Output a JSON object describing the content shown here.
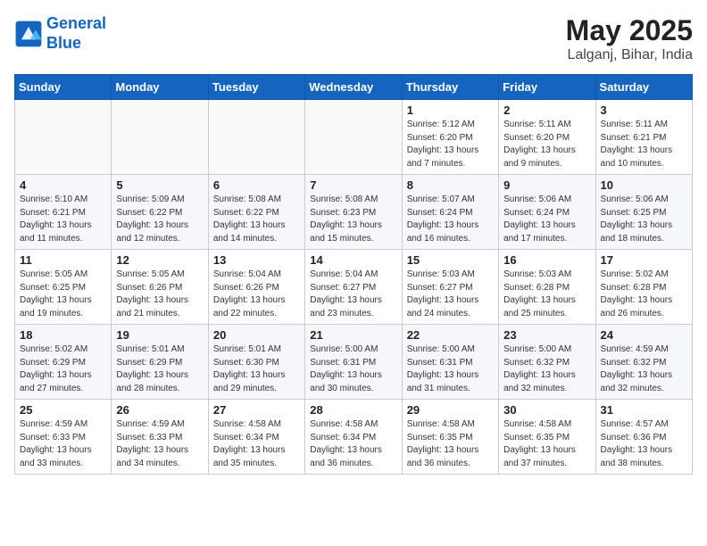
{
  "header": {
    "logo_line1": "General",
    "logo_line2": "Blue",
    "month": "May 2025",
    "location": "Lalganj, Bihar, India"
  },
  "weekdays": [
    "Sunday",
    "Monday",
    "Tuesday",
    "Wednesday",
    "Thursday",
    "Friday",
    "Saturday"
  ],
  "weeks": [
    [
      {
        "day": "",
        "info": ""
      },
      {
        "day": "",
        "info": ""
      },
      {
        "day": "",
        "info": ""
      },
      {
        "day": "",
        "info": ""
      },
      {
        "day": "1",
        "info": "Sunrise: 5:12 AM\nSunset: 6:20 PM\nDaylight: 13 hours\nand 7 minutes."
      },
      {
        "day": "2",
        "info": "Sunrise: 5:11 AM\nSunset: 6:20 PM\nDaylight: 13 hours\nand 9 minutes."
      },
      {
        "day": "3",
        "info": "Sunrise: 5:11 AM\nSunset: 6:21 PM\nDaylight: 13 hours\nand 10 minutes."
      }
    ],
    [
      {
        "day": "4",
        "info": "Sunrise: 5:10 AM\nSunset: 6:21 PM\nDaylight: 13 hours\nand 11 minutes."
      },
      {
        "day": "5",
        "info": "Sunrise: 5:09 AM\nSunset: 6:22 PM\nDaylight: 13 hours\nand 12 minutes."
      },
      {
        "day": "6",
        "info": "Sunrise: 5:08 AM\nSunset: 6:22 PM\nDaylight: 13 hours\nand 14 minutes."
      },
      {
        "day": "7",
        "info": "Sunrise: 5:08 AM\nSunset: 6:23 PM\nDaylight: 13 hours\nand 15 minutes."
      },
      {
        "day": "8",
        "info": "Sunrise: 5:07 AM\nSunset: 6:24 PM\nDaylight: 13 hours\nand 16 minutes."
      },
      {
        "day": "9",
        "info": "Sunrise: 5:06 AM\nSunset: 6:24 PM\nDaylight: 13 hours\nand 17 minutes."
      },
      {
        "day": "10",
        "info": "Sunrise: 5:06 AM\nSunset: 6:25 PM\nDaylight: 13 hours\nand 18 minutes."
      }
    ],
    [
      {
        "day": "11",
        "info": "Sunrise: 5:05 AM\nSunset: 6:25 PM\nDaylight: 13 hours\nand 19 minutes."
      },
      {
        "day": "12",
        "info": "Sunrise: 5:05 AM\nSunset: 6:26 PM\nDaylight: 13 hours\nand 21 minutes."
      },
      {
        "day": "13",
        "info": "Sunrise: 5:04 AM\nSunset: 6:26 PM\nDaylight: 13 hours\nand 22 minutes."
      },
      {
        "day": "14",
        "info": "Sunrise: 5:04 AM\nSunset: 6:27 PM\nDaylight: 13 hours\nand 23 minutes."
      },
      {
        "day": "15",
        "info": "Sunrise: 5:03 AM\nSunset: 6:27 PM\nDaylight: 13 hours\nand 24 minutes."
      },
      {
        "day": "16",
        "info": "Sunrise: 5:03 AM\nSunset: 6:28 PM\nDaylight: 13 hours\nand 25 minutes."
      },
      {
        "day": "17",
        "info": "Sunrise: 5:02 AM\nSunset: 6:28 PM\nDaylight: 13 hours\nand 26 minutes."
      }
    ],
    [
      {
        "day": "18",
        "info": "Sunrise: 5:02 AM\nSunset: 6:29 PM\nDaylight: 13 hours\nand 27 minutes."
      },
      {
        "day": "19",
        "info": "Sunrise: 5:01 AM\nSunset: 6:29 PM\nDaylight: 13 hours\nand 28 minutes."
      },
      {
        "day": "20",
        "info": "Sunrise: 5:01 AM\nSunset: 6:30 PM\nDaylight: 13 hours\nand 29 minutes."
      },
      {
        "day": "21",
        "info": "Sunrise: 5:00 AM\nSunset: 6:31 PM\nDaylight: 13 hours\nand 30 minutes."
      },
      {
        "day": "22",
        "info": "Sunrise: 5:00 AM\nSunset: 6:31 PM\nDaylight: 13 hours\nand 31 minutes."
      },
      {
        "day": "23",
        "info": "Sunrise: 5:00 AM\nSunset: 6:32 PM\nDaylight: 13 hours\nand 32 minutes."
      },
      {
        "day": "24",
        "info": "Sunrise: 4:59 AM\nSunset: 6:32 PM\nDaylight: 13 hours\nand 32 minutes."
      }
    ],
    [
      {
        "day": "25",
        "info": "Sunrise: 4:59 AM\nSunset: 6:33 PM\nDaylight: 13 hours\nand 33 minutes."
      },
      {
        "day": "26",
        "info": "Sunrise: 4:59 AM\nSunset: 6:33 PM\nDaylight: 13 hours\nand 34 minutes."
      },
      {
        "day": "27",
        "info": "Sunrise: 4:58 AM\nSunset: 6:34 PM\nDaylight: 13 hours\nand 35 minutes."
      },
      {
        "day": "28",
        "info": "Sunrise: 4:58 AM\nSunset: 6:34 PM\nDaylight: 13 hours\nand 36 minutes."
      },
      {
        "day": "29",
        "info": "Sunrise: 4:58 AM\nSunset: 6:35 PM\nDaylight: 13 hours\nand 36 minutes."
      },
      {
        "day": "30",
        "info": "Sunrise: 4:58 AM\nSunset: 6:35 PM\nDaylight: 13 hours\nand 37 minutes."
      },
      {
        "day": "31",
        "info": "Sunrise: 4:57 AM\nSunset: 6:36 PM\nDaylight: 13 hours\nand 38 minutes."
      }
    ]
  ]
}
